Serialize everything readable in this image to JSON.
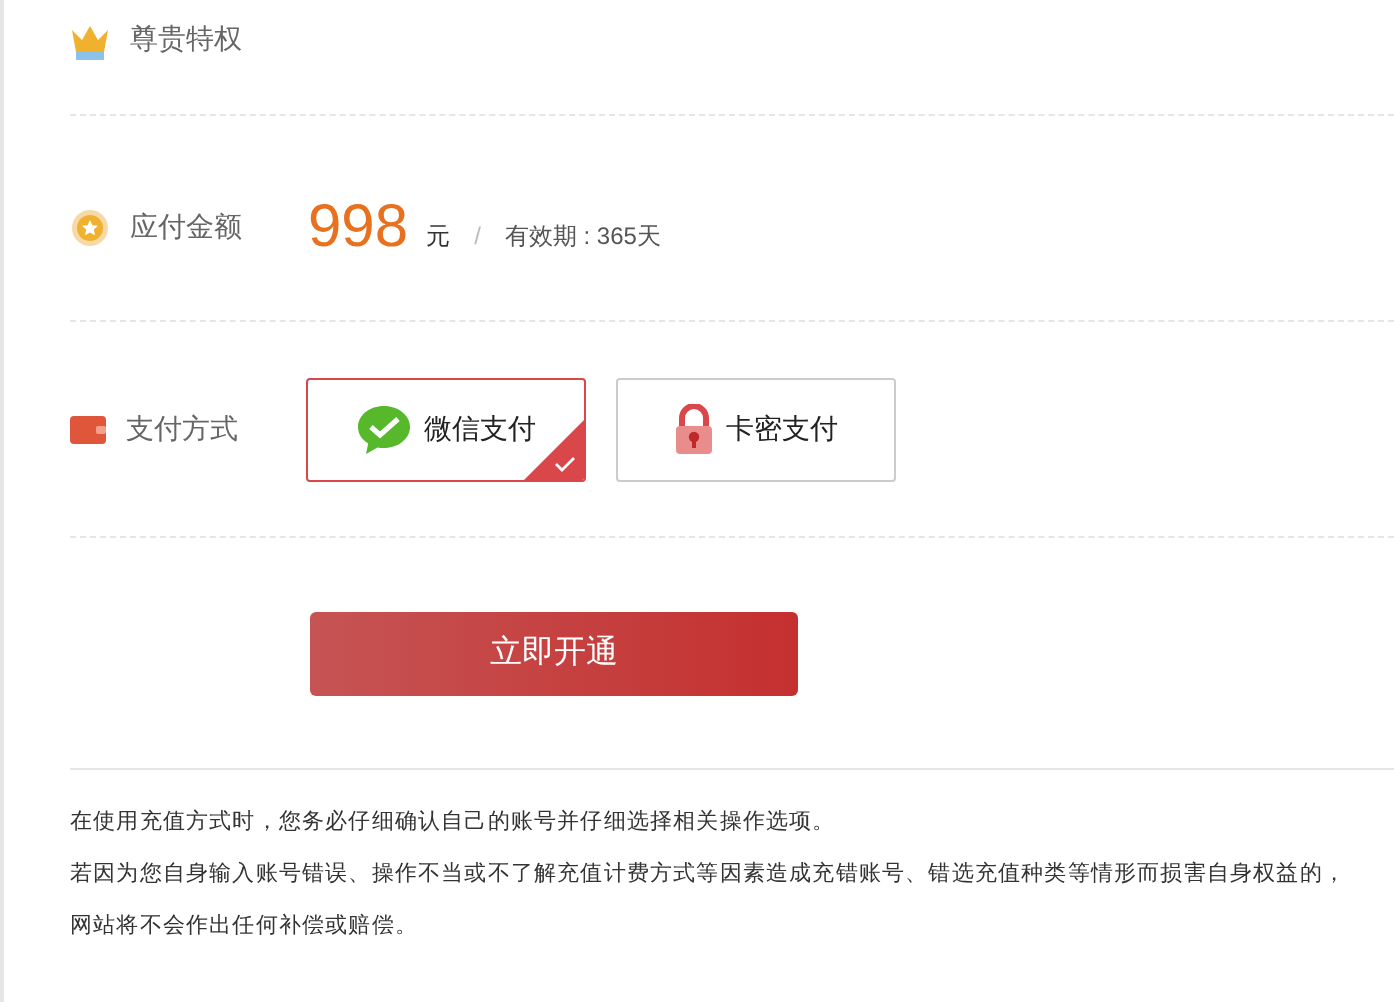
{
  "privilege": {
    "label": "尊贵特权"
  },
  "amount": {
    "label": "应付金额",
    "price": "998",
    "unit": "元",
    "separator": "/",
    "validity": "有效期 : 365天"
  },
  "payment": {
    "label": "支付方式",
    "methods": [
      {
        "kind": "wechat",
        "label": "微信支付",
        "selected": true
      },
      {
        "kind": "card",
        "label": "卡密支付",
        "selected": false
      }
    ]
  },
  "submit_button": "立即开通",
  "notes": [
    "在使用充值方式时，您务必仔细确认自己的账号并仔细选择相关操作选项。",
    "若因为您自身输入账号错误、操作不当或不了解充值计费方式等因素造成充错账号、错选充值种类等情形而损害自身权益的，",
    "网站将不会作出任何补偿或赔偿。"
  ]
}
